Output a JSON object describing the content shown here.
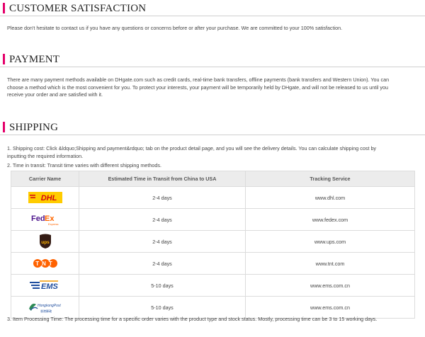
{
  "sections": {
    "customer": {
      "title": "CUSTOMER SATISFACTION",
      "text": "Please don't hesitate to contact us if you have any questions or concerns before or after your purchase. We are committed to your 100% satisfaction."
    },
    "payment": {
      "title": "PAYMENT",
      "text": "There are many payment methods available on DHgate.com such as credit cards, real-time bank transfers, offline payments (bank transfers and Western Union). You can choose a method which is the most convenient for you. To protect your interests, your payment will be temporarily held by DHgate, and will not be released to us until you receive your order and are satisfied with it."
    },
    "shipping": {
      "title": "SHIPPING",
      "item1": "1. Shipping cost: Click &ldquo;Shipping and payment&rdquo; tab on the product detail page, and you will see the delivery details. You can calculate shipping cost by inputting the required information.",
      "item2": "2. Time in transit: Transit time varies with different shipping methods.",
      "item3": "3. Item Processing Time: The processing time for a specific order varies with the product type and stock status. Mostly, processing time can be 3 to 15 working days."
    }
  },
  "table": {
    "headers": [
      "Carrier Name",
      "Estimated Time in Transit from China to USA",
      "Tracking Service"
    ],
    "rows": [
      {
        "carrier_icon": "dhl-logo",
        "time": "2-4 days",
        "tracking": "www.dhl.com"
      },
      {
        "carrier_icon": "fedex-logo",
        "time": "2-4 days",
        "tracking": "www.fedex.com"
      },
      {
        "carrier_icon": "ups-logo",
        "time": "2-4 days",
        "tracking": "www.ups.com"
      },
      {
        "carrier_icon": "tnt-logo",
        "time": "2-4 days",
        "tracking": "www.tnt.com"
      },
      {
        "carrier_icon": "ems-logo",
        "time": "5-10 days",
        "tracking": "www.ems.com.cn"
      },
      {
        "carrier_icon": "hongkong-post-logo",
        "time": "5-10 days",
        "tracking": "www.ems.com.cn"
      }
    ]
  },
  "logo_text": {
    "dhl": "DHL",
    "fedex_fed": "Fed",
    "fedex_ex": "Ex",
    "fedex_sub": "Express",
    "ups": "ups",
    "tnt": "TNT",
    "ems": "EMS",
    "hkpost": "HongkongPost",
    "hkpost_cn": "香港郵政"
  },
  "colors": {
    "accent": "#e4006a",
    "dhl_yellow": "#ffcc00",
    "dhl_red": "#d40511",
    "fedex_purple": "#4d148c",
    "fedex_orange": "#ff6600",
    "ups_brown": "#351c15",
    "ups_gold": "#ffb500",
    "tnt_orange": "#ff6200",
    "ems_blue": "#1f4e9e",
    "ems_orange": "#f39800"
  }
}
